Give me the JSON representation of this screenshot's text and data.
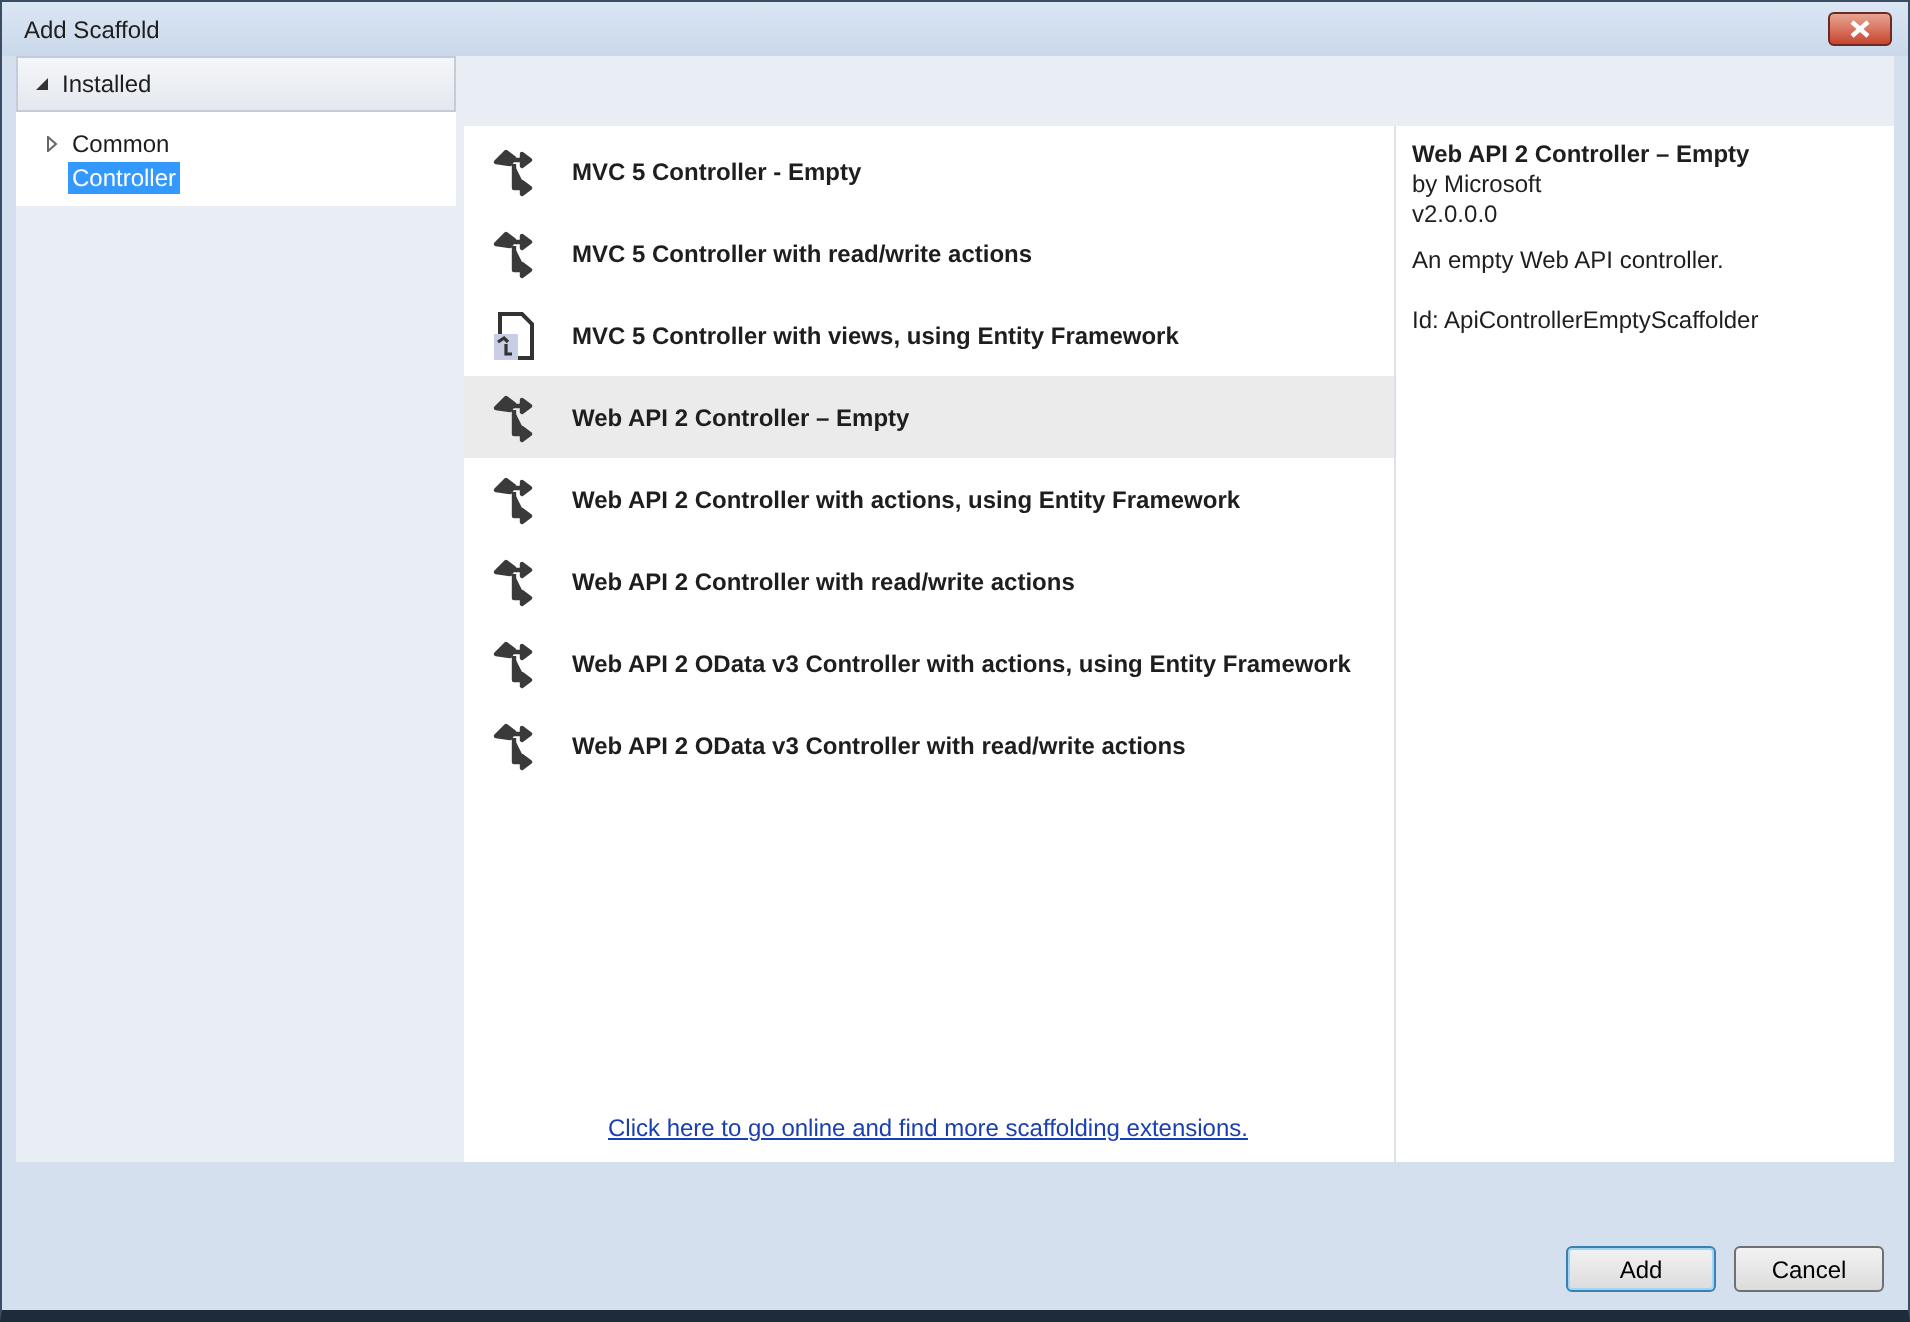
{
  "window": {
    "title": "Add Scaffold"
  },
  "tree": {
    "label": "Installed",
    "expanded": true,
    "children": [
      {
        "label": "Common",
        "expanded": false,
        "selected": false
      },
      {
        "label": "Controller",
        "selected": true
      }
    ]
  },
  "templates": [
    {
      "name": "MVC 5 Controller - Empty",
      "kind": "controller",
      "selected": false
    },
    {
      "name": "MVC 5 Controller with read/write actions",
      "kind": "controller",
      "selected": false
    },
    {
      "name": "MVC 5 Controller with views, using Entity Framework",
      "kind": "views",
      "selected": false
    },
    {
      "name": "Web API 2 Controller – Empty",
      "kind": "controller",
      "selected": true
    },
    {
      "name": "Web API 2 Controller with actions, using Entity Framework",
      "kind": "controller",
      "selected": false
    },
    {
      "name": "Web API 2 Controller with read/write actions",
      "kind": "controller",
      "selected": false
    },
    {
      "name": "Web API 2 OData v3 Controller with actions, using Entity Framework",
      "kind": "controller",
      "selected": false
    },
    {
      "name": "Web API 2 OData v3 Controller with read/write actions",
      "kind": "controller",
      "selected": false
    }
  ],
  "online_link": "Click here to go online and find more scaffolding extensions.",
  "details": {
    "title": "Web API 2 Controller – Empty",
    "author": "by Microsoft",
    "version": "v2.0.0.0",
    "description": "An empty Web API controller.",
    "id": "Id: ApiControllerEmptyScaffolder"
  },
  "buttons": [
    {
      "label": "Add",
      "kind": "default"
    },
    {
      "label": "Cancel",
      "kind": "normal"
    }
  ]
}
